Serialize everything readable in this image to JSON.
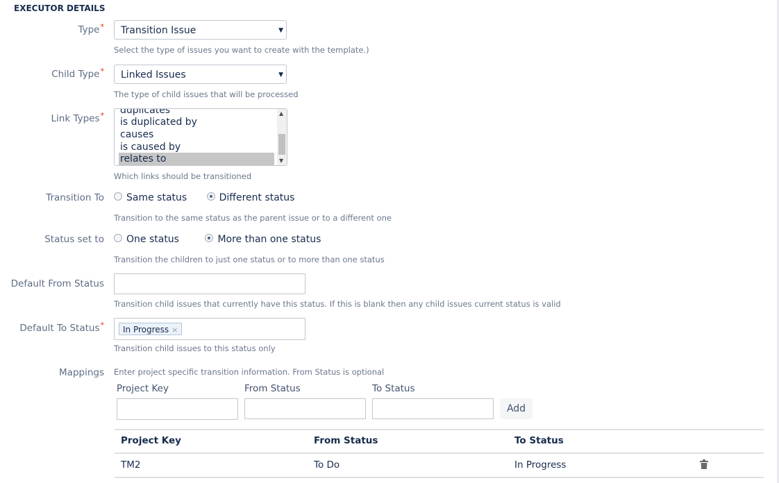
{
  "section_title": "EXECUTOR DETAILS",
  "fields": {
    "type": {
      "label": "Type",
      "required_mark": "*",
      "value": "Transition Issue",
      "help": "Select the type of issues you want to create with the template.)"
    },
    "child_type": {
      "label": "Child Type",
      "required_mark": "*",
      "value": "Linked Issues",
      "help": "The type of child issues that will be processed"
    },
    "link_types": {
      "label": "Link Types",
      "required_mark": "*",
      "options": [
        "duplicates",
        "is duplicated by",
        "causes",
        "is caused by",
        "relates to"
      ],
      "selected": "relates to",
      "help": "Which links should be transitioned"
    },
    "transition_to": {
      "label": "Transition To",
      "options": [
        "Same status",
        "Different status"
      ],
      "selected": "Different status",
      "help": "Transition to the same status as the parent issue or to a different one"
    },
    "status_set_to": {
      "label": "Status set to",
      "options": [
        "One status",
        "More than one status"
      ],
      "selected": "More than one status",
      "help": "Transition the children to just one status or to more than one status"
    },
    "default_from_status": {
      "label": "Default From Status",
      "value": "",
      "help": "Transition child issues that currently have this status. If this is blank then any child issues current status is valid"
    },
    "default_to_status": {
      "label": "Default To Status",
      "required_mark": "*",
      "tags": [
        "In Progress"
      ],
      "tag_remove_glyph": "×",
      "help": "Transition child issues to this status only"
    }
  },
  "mappings": {
    "label": "Mappings",
    "help": "Enter project specific transition information. From Status is optional",
    "input_labels": [
      "Project Key",
      "From Status",
      "To Status"
    ],
    "inputs": [
      "",
      "",
      ""
    ],
    "add_label": "Add",
    "table": {
      "headers": [
        "Project Key",
        "From Status",
        "To Status"
      ],
      "rows": [
        {
          "project_key": "TM2",
          "from_status": "To Do",
          "to_status": "In Progress",
          "action_icon": "trash-icon"
        }
      ]
    }
  }
}
